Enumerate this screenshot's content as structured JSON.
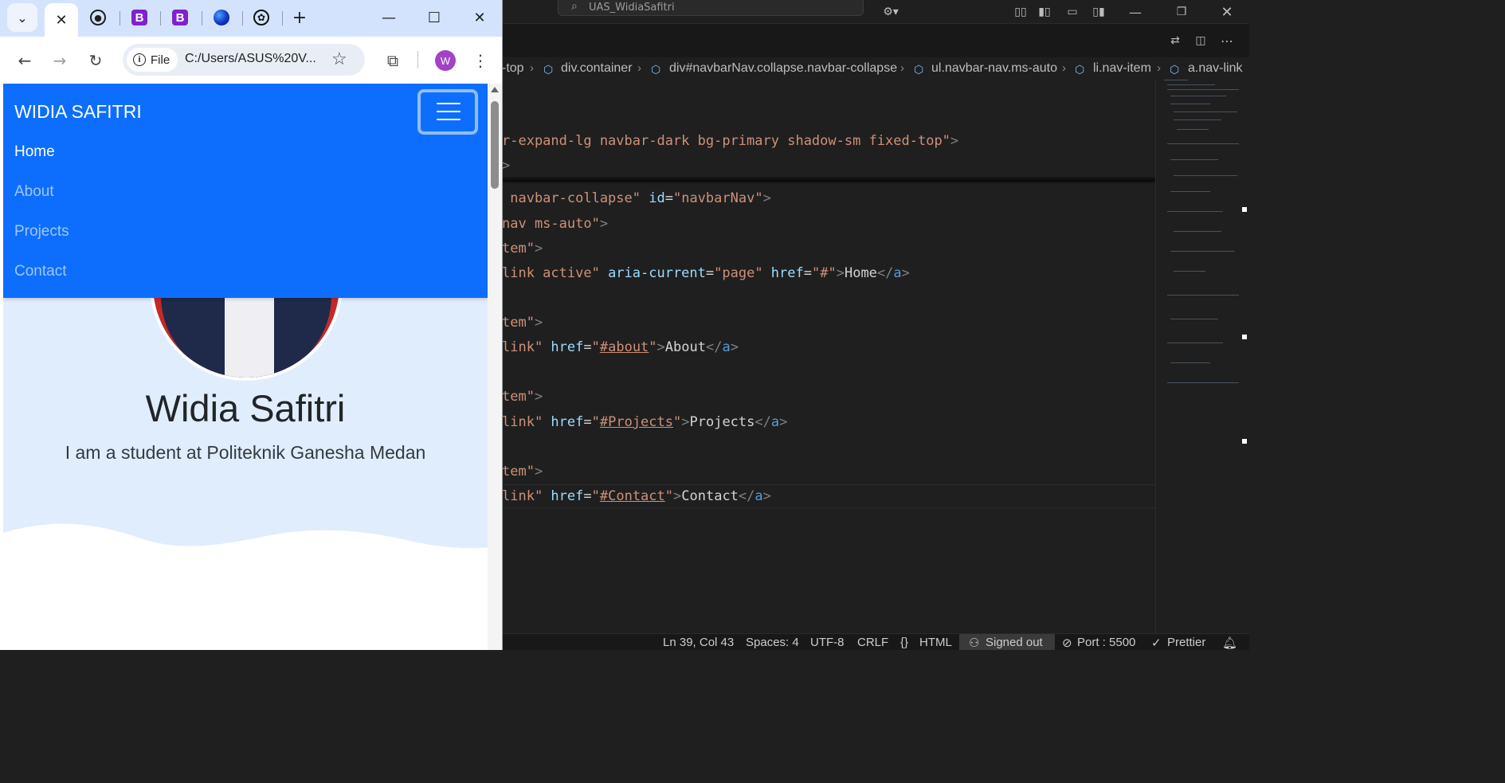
{
  "vscode": {
    "search_text": "UAS_WidiaSafitri",
    "breadcrumb": [
      "-top",
      "div.container",
      "div#navbarNav.collapse.navbar-collapse",
      "ul.navbar-nav.ms-auto",
      "li.nav-item",
      "a.nav-link"
    ],
    "code": {
      "l1": {
        "a": "r-expand-lg navbar-dark bg-primary shadow-sm fixed-top\"",
        "b": ">"
      },
      "l2": ">",
      "l3": {
        "a": " navbar-collapse\"",
        "b": " id",
        "c": "=",
        "d": "\"navbarNav\"",
        "e": ">"
      },
      "l4": {
        "a": "nav ms-auto\"",
        "b": ">"
      },
      "l5": {
        "a": "tem\"",
        "b": ">"
      },
      "l6": {
        "a": "link active\"",
        "b": " aria-current",
        "c": "=",
        "d": "\"page\"",
        "e": " href",
        "f": "=",
        "g": "\"#\"",
        "h": ">",
        "i": "Home",
        "j": "</",
        "k": "a",
        "l": ">"
      },
      "l7": {
        "a": "tem\"",
        "b": ">"
      },
      "l8": {
        "a": "link\"",
        "b": " href",
        "c": "=",
        "d": "\"",
        "e": "#about",
        "f": "\"",
        "g": ">",
        "h": "About",
        "i": "</",
        "j": "a",
        "k": ">"
      },
      "l9": {
        "a": "tem\"",
        "b": ">"
      },
      "l10": {
        "a": "link\"",
        "b": " href",
        "c": "=",
        "d": "\"",
        "e": "#Projects",
        "f": "\"",
        "g": ">",
        "h": "Projects",
        "i": "</",
        "j": "a",
        "k": ">"
      },
      "l11": {
        "a": "tem\"",
        "b": ">"
      },
      "l12": {
        "a": "link\"",
        "b": " href",
        "c": "=",
        "d": "\"",
        "e": "#Contact",
        "f": "\"",
        "g": ">",
        "h": "Contact",
        "i": "</",
        "j": "a",
        "k": ">"
      }
    },
    "status": {
      "position": "Ln 39, Col 43",
      "spaces": "Spaces: 4",
      "encoding": "UTF-8",
      "eol": "CRLF",
      "language": "HTML",
      "account": "Signed out",
      "port": "Port : 5500",
      "formatter": "Prettier"
    }
  },
  "chrome": {
    "url_chip": "File",
    "url": "C:/Users/ASUS%20V...",
    "avatar_letter": "W",
    "page": {
      "brand": "WIDIA SAFITRI",
      "nav": [
        "Home",
        "About",
        "Projects",
        "Contact"
      ],
      "name": "Widia Safitri",
      "subtitle": "I am a student at Politeknik Ganesha Medan"
    }
  },
  "colors": {
    "bootstrap_primary": "#0d6efd",
    "hero_bg": "#e0edfd",
    "chrome_tabstrip": "#d3e3fd",
    "vscode_bg": "#1f1f1f"
  }
}
